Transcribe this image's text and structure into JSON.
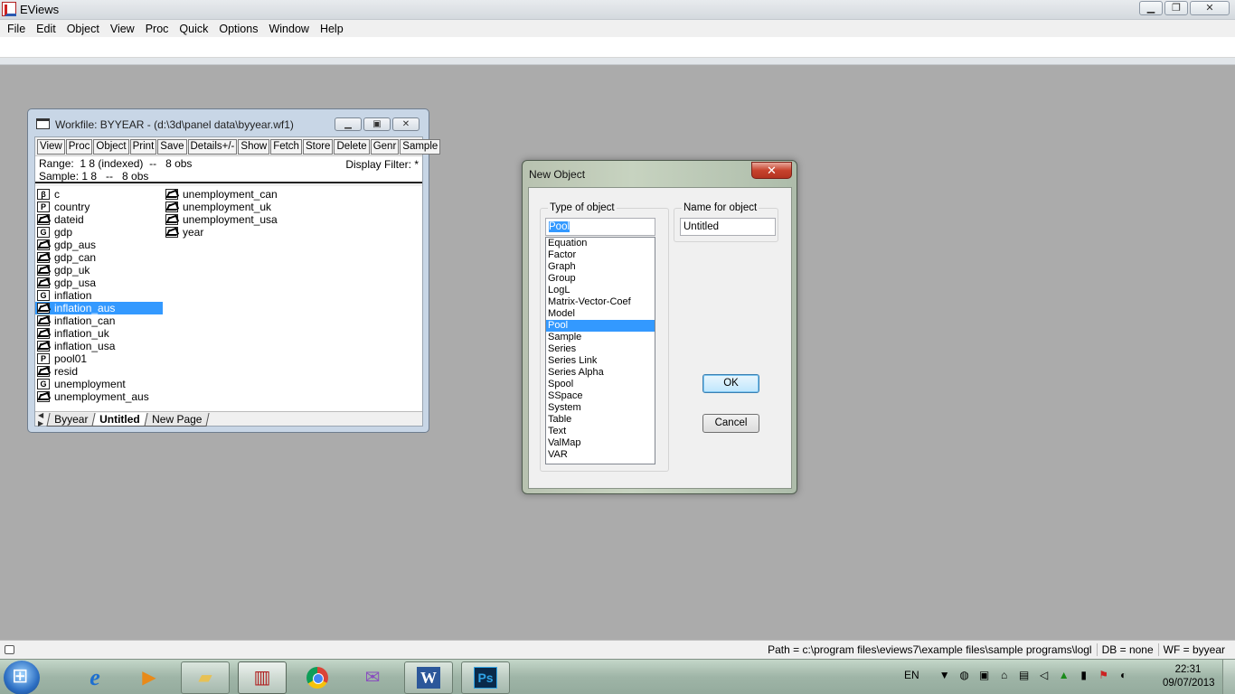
{
  "app": {
    "title": "EViews"
  },
  "menu": [
    "File",
    "Edit",
    "Object",
    "View",
    "Proc",
    "Quick",
    "Options",
    "Window",
    "Help"
  ],
  "workfile": {
    "title": "Workfile: BYYEAR - (d:\\3d\\panel data\\byyear.wf1)",
    "toolbar": [
      "View",
      "Proc",
      "Object",
      "Print",
      "Save",
      "Details+/-",
      "Show",
      "Fetch",
      "Store",
      "Delete",
      "Genr",
      "Sample"
    ],
    "range": "Range:  1 8 (indexed)  --   8 obs",
    "sample": "Sample: 1 8   --   8 obs",
    "display_filter": "Display Filter: *",
    "objects_col1": [
      {
        "icon": "β",
        "type": "coef",
        "name": "c"
      },
      {
        "icon": "P",
        "type": "pool",
        "name": "country"
      },
      {
        "icon": "",
        "type": "series",
        "name": "dateid"
      },
      {
        "icon": "G",
        "type": "group",
        "name": "gdp"
      },
      {
        "icon": "",
        "type": "series",
        "name": "gdp_aus"
      },
      {
        "icon": "",
        "type": "series",
        "name": "gdp_can"
      },
      {
        "icon": "",
        "type": "series",
        "name": "gdp_uk"
      },
      {
        "icon": "",
        "type": "series",
        "name": "gdp_usa"
      },
      {
        "icon": "G",
        "type": "group",
        "name": "inflation"
      },
      {
        "icon": "",
        "type": "series",
        "name": "inflation_aus",
        "selected": true
      },
      {
        "icon": "",
        "type": "series",
        "name": "inflation_can"
      },
      {
        "icon": "",
        "type": "series",
        "name": "inflation_uk"
      },
      {
        "icon": "",
        "type": "series",
        "name": "inflation_usa"
      },
      {
        "icon": "P",
        "type": "pool",
        "name": "pool01"
      },
      {
        "icon": "",
        "type": "series",
        "name": "resid"
      },
      {
        "icon": "G",
        "type": "group",
        "name": "unemployment"
      },
      {
        "icon": "",
        "type": "series",
        "name": "unemployment_aus"
      }
    ],
    "objects_col2": [
      {
        "icon": "",
        "type": "series",
        "name": "unemployment_can"
      },
      {
        "icon": "",
        "type": "series",
        "name": "unemployment_uk"
      },
      {
        "icon": "",
        "type": "series",
        "name": "unemployment_usa"
      },
      {
        "icon": "",
        "type": "series",
        "name": "year"
      }
    ],
    "tabs": [
      "Byyear",
      "Untitled",
      "New Page"
    ],
    "active_tab": "Untitled"
  },
  "dialog": {
    "title": "New Object",
    "type_label": "Type of object",
    "type_value": "Pool",
    "name_label": "Name for object",
    "name_value": "Untitled",
    "types": [
      "Equation",
      "Factor",
      "Graph",
      "Group",
      "LogL",
      "Matrix-Vector-Coef",
      "Model",
      "Pool",
      "Sample",
      "Series",
      "Series Link",
      "Series Alpha",
      "Spool",
      "SSpace",
      "System",
      "Table",
      "Text",
      "ValMap",
      "VAR"
    ],
    "selected_type": "Pool",
    "ok": "OK",
    "cancel": "Cancel"
  },
  "status": {
    "path": "Path = c:\\program files\\eviews7\\example files\\sample programs\\logl",
    "db": "DB = none",
    "wf": "WF = byyear"
  },
  "taskbar": {
    "apps": [
      {
        "name": "internet-explorer-icon",
        "glyph": "e"
      },
      {
        "name": "media-player-icon",
        "glyph": "▶"
      },
      {
        "name": "file-explorer-icon",
        "glyph": "▭"
      },
      {
        "name": "eviews-icon",
        "glyph": "📈"
      },
      {
        "name": "chrome-icon",
        "glyph": ""
      },
      {
        "name": "messenger-icon",
        "glyph": "✉"
      },
      {
        "name": "word-icon",
        "glyph": "W"
      },
      {
        "name": "photoshop-icon",
        "glyph": "Ps"
      }
    ],
    "lang": "EN",
    "time": "22:31",
    "date": "09/07/2013"
  }
}
